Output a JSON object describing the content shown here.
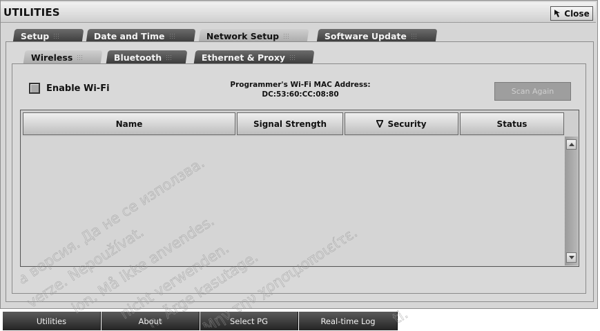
{
  "window": {
    "title": "UTILITIES",
    "close_label": "Close"
  },
  "main_tabs": [
    {
      "label": "Setup",
      "active": false
    },
    {
      "label": "Date and Time",
      "active": false
    },
    {
      "label": "Network Setup",
      "active": true
    },
    {
      "label": "Software Update",
      "active": false
    }
  ],
  "sub_tabs": [
    {
      "label": "Wireless",
      "active": true
    },
    {
      "label": "Bluetooth",
      "active": false
    },
    {
      "label": "Ethernet & Proxy",
      "active": false
    }
  ],
  "wifi": {
    "enable_label": "Enable Wi-Fi",
    "enabled": false,
    "mac_title": "Programmer's Wi-Fi MAC Address:",
    "mac_value": "DC:53:60:CC:08:80",
    "scan_label": "Scan Again"
  },
  "table": {
    "columns": [
      "Name",
      "Signal Strength",
      "Security",
      "Status"
    ],
    "sort_column": "Security",
    "rows": []
  },
  "taskbar": {
    "buttons": [
      "Utilities",
      "About",
      "Select PG",
      "Real-time Log"
    ]
  },
  "watermark": {
    "lines": [
      "ла версия. Да не се използва.",
      "verze. Nepoužívat.",
      "ion. Må ikke anvendes.",
      "nicht verwenden.",
      "n. Ärge kasutage.",
      "Μην την χρησιμοποιείτε.",
      "ti."
    ]
  },
  "colors": {
    "tab_dark": "#3a3a3a",
    "tab_active": "#bdbdbd",
    "panel": "#d9d9d9",
    "taskbar": "#242424"
  }
}
